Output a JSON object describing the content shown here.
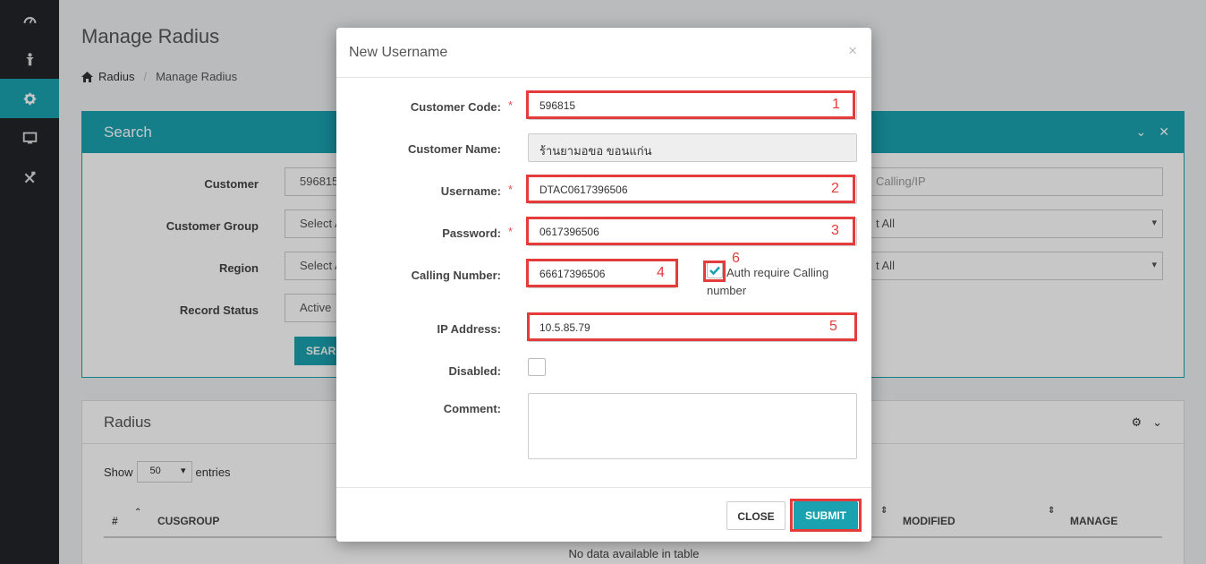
{
  "sidebar": {
    "items": [
      {
        "icon": "gauge-icon"
      },
      {
        "icon": "user-icon"
      },
      {
        "icon": "gear-icon",
        "active": true
      },
      {
        "icon": "monitor-icon"
      },
      {
        "icon": "tools-icon"
      }
    ]
  },
  "page": {
    "title": "Manage Radius",
    "breadcrumb": {
      "home": "Radius",
      "current": "Manage Radius"
    }
  },
  "search_panel": {
    "title": "Search",
    "fields": {
      "customer_label": "Customer",
      "customer_value": "596815",
      "customer_group_label": "Customer Group",
      "customer_group_value": "Select A",
      "region_label": "Region",
      "region_value": "Select A",
      "record_status_label": "Record Status",
      "record_status_value": "Active",
      "right_input_placeholder": "Calling/IP",
      "right_select1": "t All",
      "right_select2": "t All"
    },
    "search_button": "SEARC"
  },
  "radius_panel": {
    "title": "Radius",
    "show_label": "Show",
    "show_value": "50",
    "entries_label": "entries",
    "columns": [
      "#",
      "CUSGROUP",
      "MODIFIED",
      "MANAGE"
    ],
    "no_data": "No data available in table"
  },
  "modal": {
    "title": "New Username",
    "close_x": "×",
    "fields": {
      "customer_code_label": "Customer Code:",
      "customer_code_value": "596815",
      "customer_name_label": "Customer Name:",
      "customer_name_value": "ร้านยามอขอ ขอนแก่น",
      "username_label": "Username:",
      "username_value": "DTAC0617396506",
      "password_label": "Password:",
      "password_value": "0617396506",
      "calling_number_label": "Calling Number:",
      "calling_number_value": "66617396506",
      "auth_require_label": "Auth require Calling number",
      "auth_require_checked": true,
      "ip_address_label": "IP Address:",
      "ip_address_value": "10.5.85.79",
      "disabled_label": "Disabled:",
      "disabled_checked": false,
      "comment_label": "Comment:",
      "comment_value": ""
    },
    "required_mark": "*",
    "annotations": [
      "1",
      "2",
      "3",
      "4",
      "5",
      "6"
    ],
    "close_button": "CLOSE",
    "submit_button": "SUBMIT"
  },
  "colors": {
    "accent": "#1aa2b0",
    "annotation": "#e43b3b",
    "sidebar": "#222428"
  }
}
